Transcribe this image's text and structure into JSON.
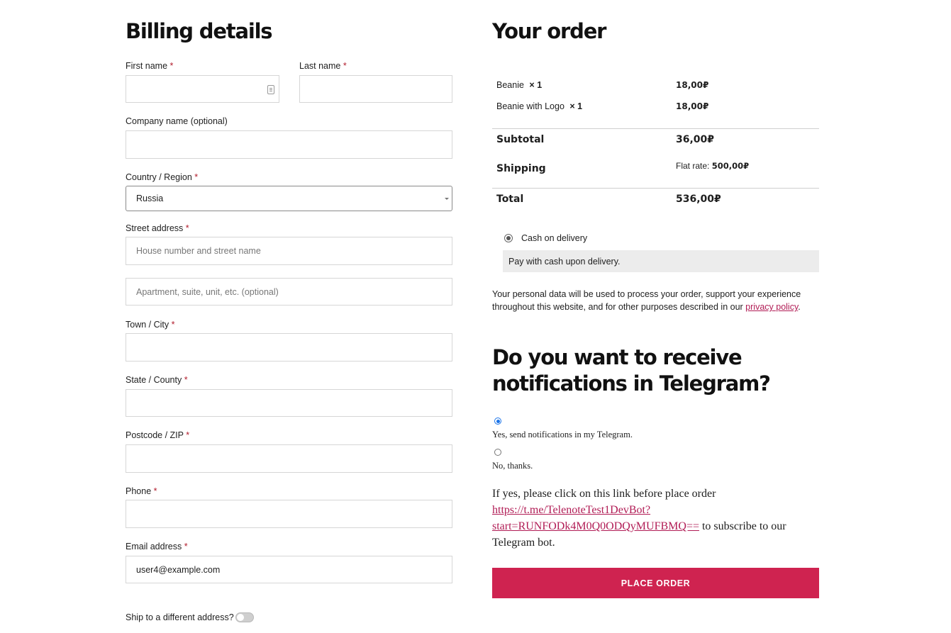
{
  "billing": {
    "title": "Billing details",
    "first_name": {
      "label": "First name",
      "value": ""
    },
    "last_name": {
      "label": "Last name",
      "value": ""
    },
    "company": {
      "label": "Company name (optional)",
      "value": ""
    },
    "country": {
      "label": "Country / Region",
      "value": "Russia"
    },
    "street": {
      "label": "Street address",
      "placeholder1": "House number and street name",
      "placeholder2": "Apartment, suite, unit, etc. (optional)"
    },
    "city": {
      "label": "Town / City",
      "value": ""
    },
    "state": {
      "label": "State / County",
      "value": ""
    },
    "postcode": {
      "label": "Postcode / ZIP",
      "value": ""
    },
    "phone": {
      "label": "Phone",
      "value": ""
    },
    "email": {
      "label": "Email address",
      "value": "user4@example.com"
    },
    "required_mark": "*",
    "ship_different": {
      "label": "Ship to a different address?",
      "enabled": false
    }
  },
  "order": {
    "title": "Your order",
    "items": [
      {
        "name": "Beanie",
        "qty": "× 1",
        "price": "18,00₽"
      },
      {
        "name": "Beanie with Logo",
        "qty": "× 1",
        "price": "18,00₽"
      }
    ],
    "subtotal_label": "Subtotal",
    "subtotal_value": "36,00₽",
    "shipping_label": "Shipping",
    "shipping_method": "Flat rate:",
    "shipping_value": "500,00₽",
    "total_label": "Total",
    "total_value": "536,00₽"
  },
  "payment": {
    "method": "Cash on delivery",
    "description": "Pay with cash upon delivery."
  },
  "privacy": {
    "text": "Your personal data will be used to process your order, support your experience throughout this website, and for other purposes described in our ",
    "link": "privacy policy",
    "end": "."
  },
  "telegram": {
    "title": "Do you want to receive notifications in Telegram?",
    "option_yes": "Yes, send notifications in my Telegram.",
    "option_no": "No, thanks.",
    "selected": "yes",
    "info_before": "If yes, please click on this link before place order ",
    "link": "https://t.me/TelenoteTest1DevBot?start=RUNFODk4M0Q0ODQyMUFBMQ==",
    "link_line1": "https://t.me/TelenoteTest1DevBot?",
    "link_line2": "start=RUNFODk4M0Q0ODQyMUFBMQ==",
    "info_after": " to subscribe to our Telegram bot."
  },
  "actions": {
    "place_order": "PLACE ORDER"
  },
  "colors": {
    "accent": "#cf2350",
    "link": "#b11c55",
    "required": "#b11c2c"
  }
}
